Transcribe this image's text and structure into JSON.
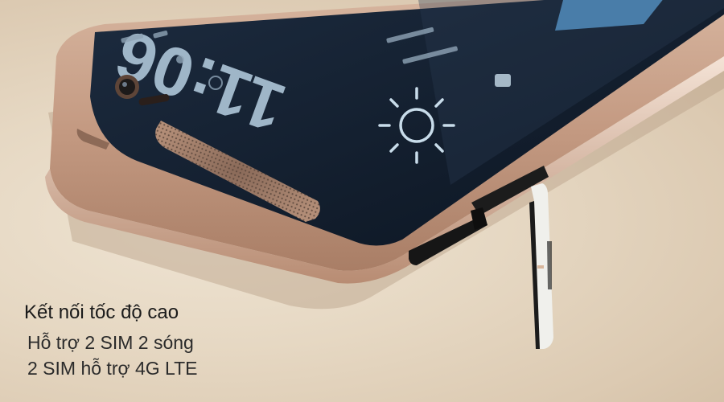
{
  "caption": {
    "title": "Kết nối tốc độ cao",
    "lines": [
      "Hỗ trợ 2 SIM 2 sóng",
      "2 SIM hỗ trợ 4G LTE"
    ]
  },
  "phone_screen": {
    "clock_text": "11:06",
    "weather_icon": "sun-icon"
  },
  "colors": {
    "phone_body": "#c9a48c",
    "screen": "#0f1a2a",
    "clock": "#9fb6c8",
    "caption_title": "#1a1a1a",
    "caption_text": "#2b2b2b"
  }
}
